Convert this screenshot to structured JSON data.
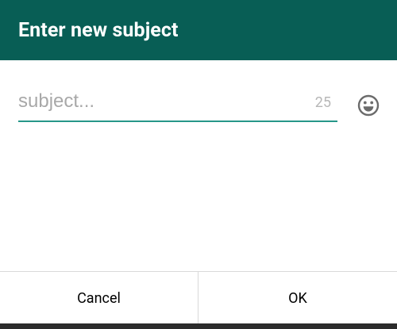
{
  "dialog": {
    "title": "Enter new subject",
    "subject_input": {
      "value": "",
      "placeholder": "subject...",
      "remaining_chars": "25"
    },
    "emoji_icon": "smiley-face-icon",
    "buttons": {
      "cancel_label": "Cancel",
      "ok_label": "OK"
    }
  },
  "colors": {
    "header_background": "#085e55",
    "input_underline": "#269789",
    "dialog_background": "#ffffff"
  }
}
